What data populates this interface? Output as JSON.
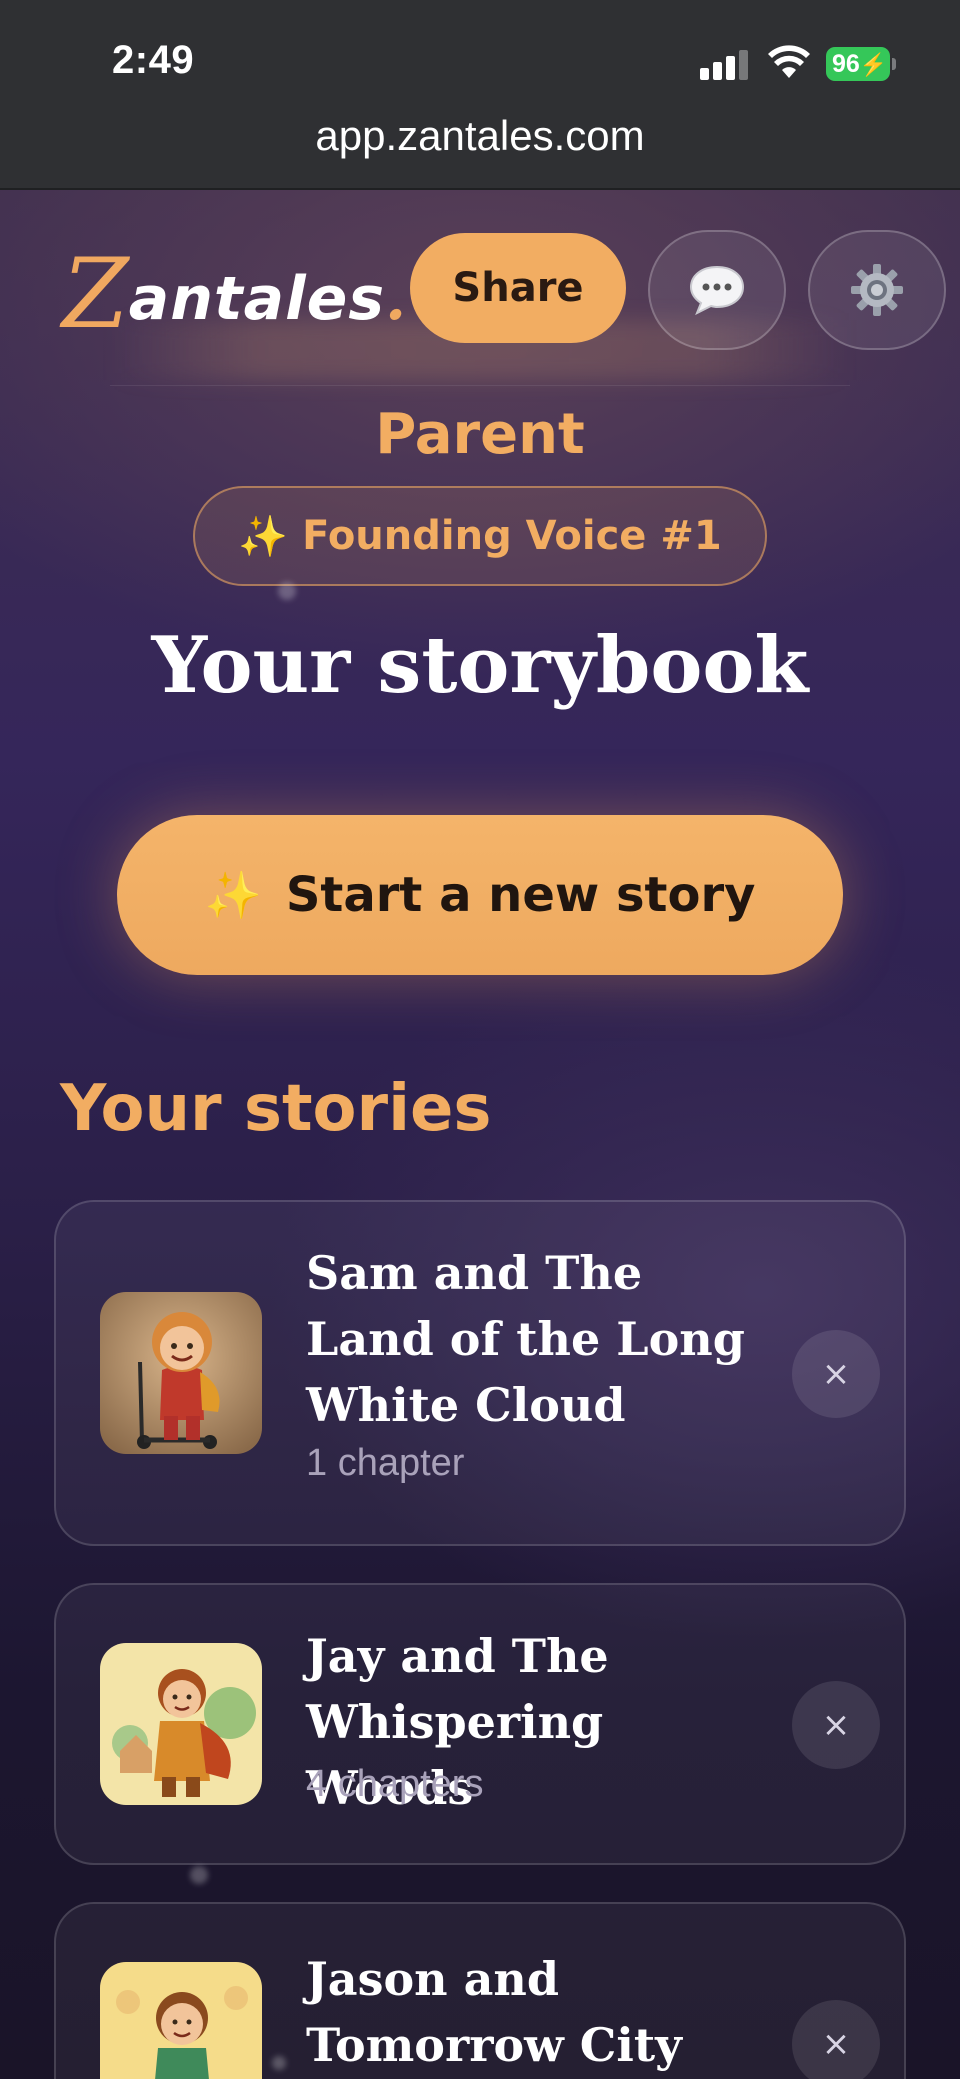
{
  "status_bar": {
    "time": "2:49",
    "battery": "96",
    "battery_color": "#35c759"
  },
  "browser": {
    "url": "app.zantales.com"
  },
  "header": {
    "logo_z": "Z",
    "logo_rest": "antales",
    "logo_dot": ".",
    "share_label": "Share",
    "chat_icon": "speech-bubble-icon",
    "settings_icon": "gear-icon"
  },
  "profile": {
    "role": "Parent",
    "badge_sparkle": "✨",
    "badge_label": "Founding Voice #1"
  },
  "main": {
    "title": "Your storybook",
    "start_sparkle": "✨",
    "start_label": "Start a new story",
    "stories_heading": "Your stories"
  },
  "stories": [
    {
      "title": "Sam and The Land of the Long White Cloud",
      "meta": "1 chapter",
      "remove": "×"
    },
    {
      "title": "Jay and The Whispering Woods",
      "meta": "4 chapters",
      "remove": "×"
    },
    {
      "title": "Jason and Tomorrow City",
      "meta": "",
      "remove": "×"
    }
  ],
  "colors": {
    "accent": "#f2ad62",
    "background": "#2a1f47"
  }
}
